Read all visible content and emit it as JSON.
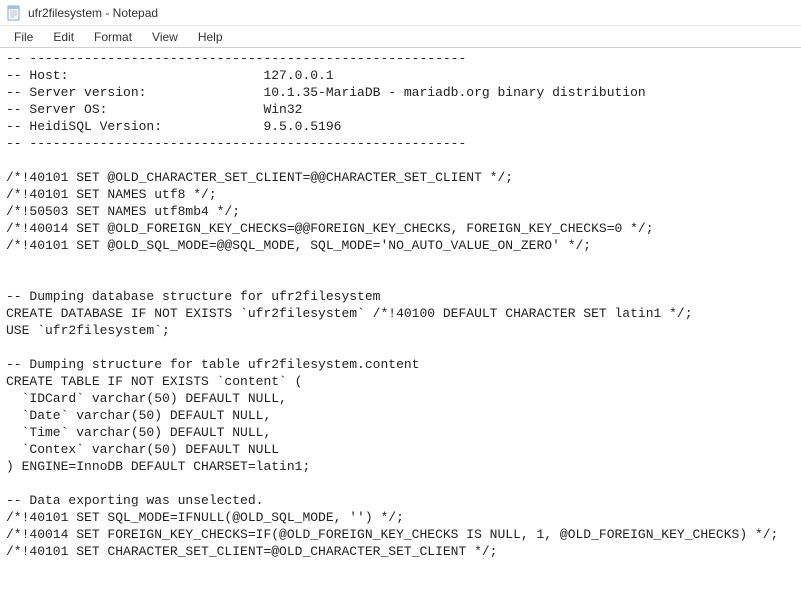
{
  "titlebar": {
    "title": "ufr2filesystem - Notepad"
  },
  "menubar": {
    "file": "File",
    "edit": "Edit",
    "format": "Format",
    "view": "View",
    "help": "Help"
  },
  "content": {
    "text": "-- --------------------------------------------------------\n-- Host:                         127.0.0.1\n-- Server version:               10.1.35-MariaDB - mariadb.org binary distribution\n-- Server OS:                    Win32\n-- HeidiSQL Version:             9.5.0.5196\n-- --------------------------------------------------------\n\n/*!40101 SET @OLD_CHARACTER_SET_CLIENT=@@CHARACTER_SET_CLIENT */;\n/*!40101 SET NAMES utf8 */;\n/*!50503 SET NAMES utf8mb4 */;\n/*!40014 SET @OLD_FOREIGN_KEY_CHECKS=@@FOREIGN_KEY_CHECKS, FOREIGN_KEY_CHECKS=0 */;\n/*!40101 SET @OLD_SQL_MODE=@@SQL_MODE, SQL_MODE='NO_AUTO_VALUE_ON_ZERO' */;\n\n\n-- Dumping database structure for ufr2filesystem\nCREATE DATABASE IF NOT EXISTS `ufr2filesystem` /*!40100 DEFAULT CHARACTER SET latin1 */;\nUSE `ufr2filesystem`;\n\n-- Dumping structure for table ufr2filesystem.content\nCREATE TABLE IF NOT EXISTS `content` (\n  `IDCard` varchar(50) DEFAULT NULL,\n  `Date` varchar(50) DEFAULT NULL,\n  `Time` varchar(50) DEFAULT NULL,\n  `Contex` varchar(50) DEFAULT NULL\n) ENGINE=InnoDB DEFAULT CHARSET=latin1;\n\n-- Data exporting was unselected.\n/*!40101 SET SQL_MODE=IFNULL(@OLD_SQL_MODE, '') */;\n/*!40014 SET FOREIGN_KEY_CHECKS=IF(@OLD_FOREIGN_KEY_CHECKS IS NULL, 1, @OLD_FOREIGN_KEY_CHECKS) */;\n/*!40101 SET CHARACTER_SET_CLIENT=@OLD_CHARACTER_SET_CLIENT */;"
  }
}
